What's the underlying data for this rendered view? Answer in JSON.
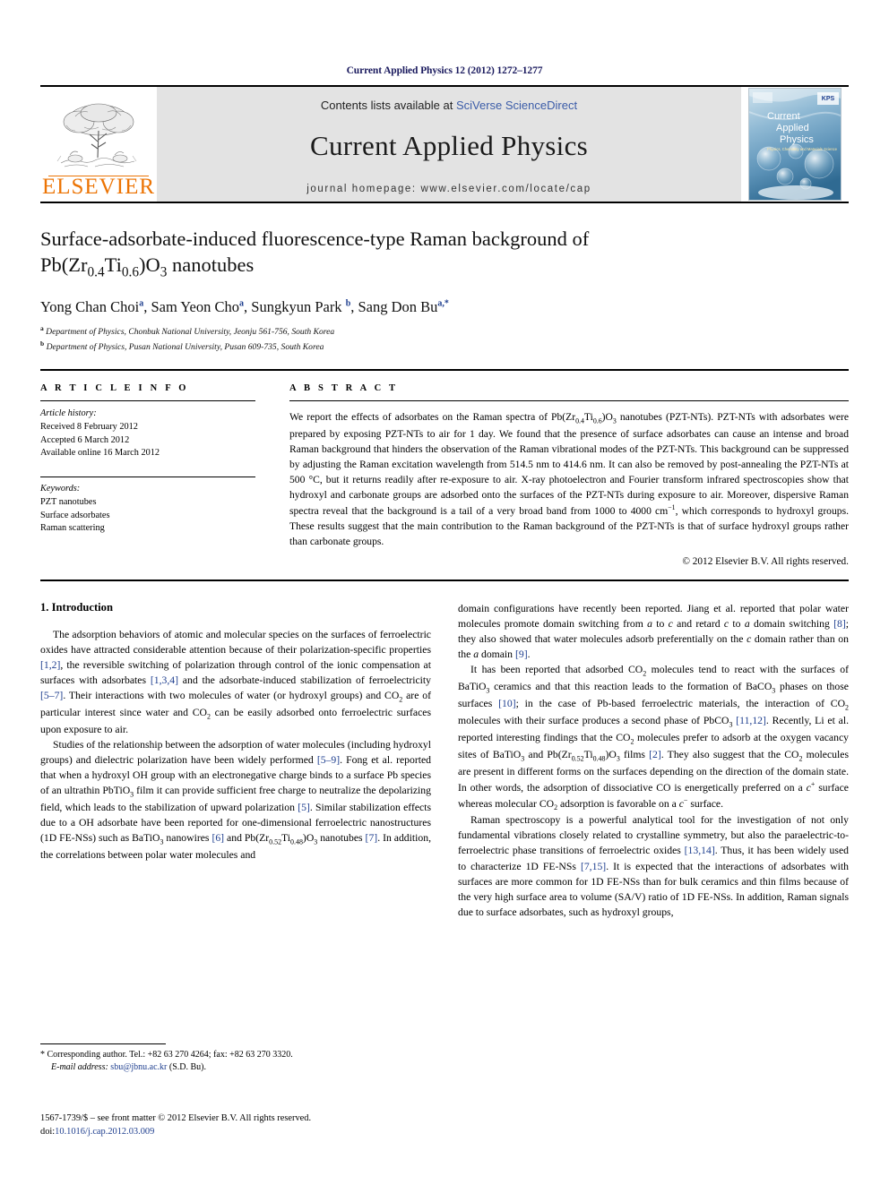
{
  "running_head": "Current Applied Physics 12 (2012) 1272–1277",
  "masthead": {
    "publisher_name": "ELSEVIER",
    "contents_prefix": "Contents lists available at ",
    "contents_link": "SciVerse ScienceDirect",
    "journal_title": "Current Applied Physics",
    "homepage": "journal homepage: www.elsevier.com/locate/cap",
    "cover": {
      "line1": "Current",
      "line2": "Applied",
      "line3": "Physics",
      "subtitle": "Physics, Chemistry and Materials Science",
      "badge": "KPS"
    }
  },
  "article": {
    "title_line1": "Surface-adsorbate-induced fluorescence-type Raman background of",
    "title_line2_pre": "Pb(Zr",
    "title_sub1": "0.4",
    "title_mid": "Ti",
    "title_sub2": "0.6",
    "title_post": ")O",
    "title_sub3": "3",
    "title_tail": " nanotubes",
    "authors": "Yong Chan Choi a, Sam Yeon Cho a, Sungkyun Park b, Sang Don Bu a,*",
    "affiliation_a": "Department of Physics, Chonbuk National University, Jeonju 561-756, South Korea",
    "affiliation_b": "Department of Physics, Pusan National University, Pusan 609-735, South Korea"
  },
  "article_info": {
    "heading": "A R T I C L E   I N F O",
    "history_label": "Article history:",
    "received": "Received 8 February 2012",
    "accepted": "Accepted 6 March 2012",
    "available": "Available online 16 March 2012",
    "keywords_label": "Keywords:",
    "keywords": [
      "PZT nanotubes",
      "Surface adsorbates",
      "Raman scattering"
    ]
  },
  "abstract": {
    "heading": "A B S T R A C T",
    "text": "We report the effects of adsorbates on the Raman spectra of Pb(Zr0.4Ti0.6)O3 nanotubes (PZT-NTs). PZT-NTs with adsorbates were prepared by exposing PZT-NTs to air for 1 day. We found that the presence of surface adsorbates can cause an intense and broad Raman background that hinders the observation of the Raman vibrational modes of the PZT-NTs. This background can be suppressed by adjusting the Raman excitation wavelength from 514.5 nm to 414.6 nm. It can also be removed by post-annealing the PZT-NTs at 500 °C, but it returns readily after re-exposure to air. X-ray photoelectron and Fourier transform infrared spectroscopies show that hydroxyl and carbonate groups are adsorbed onto the surfaces of the PZT-NTs during exposure to air. Moreover, dispersive Raman spectra reveal that the background is a tail of a very broad band from 1000 to 4000 cm−1, which corresponds to hydroxyl groups. These results suggest that the main contribution to the Raman background of the PZT-NTs is that of surface hydroxyl groups rather than carbonate groups.",
    "copyright": "© 2012 Elsevier B.V. All rights reserved."
  },
  "introduction": {
    "section_number_title": "1. Introduction",
    "left_para_1": "The adsorption behaviors of atomic and molecular species on the surfaces of ferroelectric oxides have attracted considerable attention because of their polarization-specific properties [1,2], the reversible switching of polarization through control of the ionic compensation at surfaces with adsorbates [1,3,4] and the adsorbate-induced stabilization of ferroelectricity [5–7]. Their interactions with two molecules of water (or hydroxyl groups) and CO2 are of particular interest since water and CO2 can be easily adsorbed onto ferroelectric surfaces upon exposure to air.",
    "left_para_2": "Studies of the relationship between the adsorption of water molecules (including hydroxyl groups) and dielectric polarization have been widely performed [5–9]. Fong et al. reported that when a hydroxyl OH group with an electronegative charge binds to a surface Pb species of an ultrathin PbTiO3 film it can provide sufficient free charge to neutralize the depolarizing field, which leads to the stabilization of upward polarization [5]. Similar stabilization effects due to a OH adsorbate have been reported for one-dimensional ferroelectric nanostructures (1D FE-NSs) such as BaTiO3 nanowires [6] and Pb(Zr0.52Ti0.48)O3 nanotubes [7]. In addition, the correlations between polar water molecules and",
    "right_para_1": "domain configurations have recently been reported. Jiang et al. reported that polar water molecules promote domain switching from a to c and retard c to a domain switching [8]; they also showed that water molecules adsorb preferentially on the c domain rather than on the a domain [9].",
    "right_para_2": "It has been reported that adsorbed CO2 molecules tend to react with the surfaces of BaTiO3 ceramics and that this reaction leads to the formation of BaCO3 phases on those surfaces [10]; in the case of Pb-based ferroelectric materials, the interaction of CO2 molecules with their surface produces a second phase of PbCO3 [11,12]. Recently, Li et al. reported interesting findings that the CO2 molecules prefer to adsorb at the oxygen vacancy sites of BaTiO3 and Pb(Zr0.52Ti0.48)O3 films [2]. They also suggest that the CO2 molecules are present in different forms on the surfaces depending on the direction of the domain state. In other words, the adsorption of dissociative CO is energetically preferred on a c+ surface whereas molecular CO2 adsorption is favorable on a c− surface.",
    "right_para_3": "Raman spectroscopy is a powerful analytical tool for the investigation of not only fundamental vibrations closely related to crystalline symmetry, but also the paraelectric-to-ferroelectric phase transitions of ferroelectric oxides [13,14]. Thus, it has been widely used to characterize 1D FE-NSs [7,15]. It is expected that the interactions of adsorbates with surfaces are more common for 1D FE-NSs than for bulk ceramics and thin films because of the very high surface area to volume (SA/V) ratio of 1D FE-NSs. In addition, Raman signals due to surface adsorbates, such as hydroxyl groups,"
  },
  "footnote": {
    "corresponding": "* Corresponding author. Tel.: +82 63 270 4264; fax: +82 63 270 3320.",
    "email_label": "E-mail address:",
    "email": "sbu@jbnu.ac.kr",
    "email_suffix": "(S.D. Bu)."
  },
  "front_matter": {
    "issn_line": "1567-1739/$ – see front matter © 2012 Elsevier B.V. All rights reserved.",
    "doi_label": "doi:",
    "doi": "10.1016/j.cap.2012.03.009"
  },
  "colors": {
    "elsevier_orange": "#ec7404",
    "link_blue": "#1f3f8f",
    "masthead_gray": "#e3e3e3",
    "running_head_navy": "#1a1a5e"
  }
}
